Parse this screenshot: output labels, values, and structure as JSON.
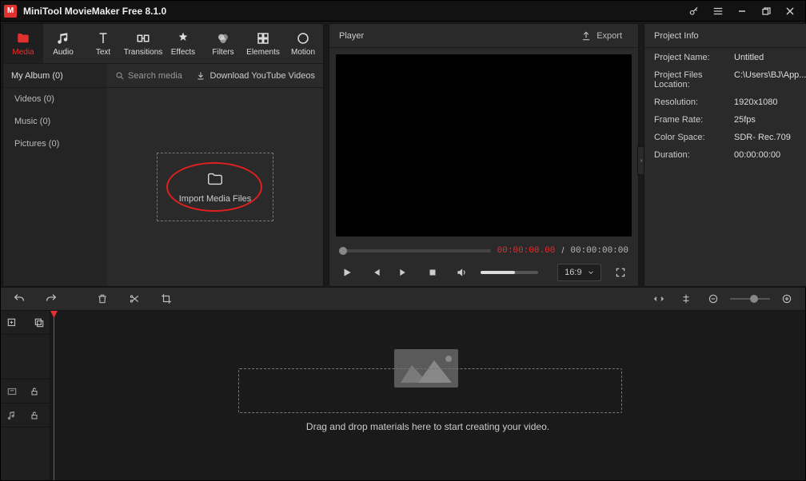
{
  "titlebar": {
    "app_title": "MiniTool MovieMaker Free 8.1.0"
  },
  "tabs": {
    "media": "Media",
    "audio": "Audio",
    "text": "Text",
    "transitions": "Transitions",
    "effects": "Effects",
    "filters": "Filters",
    "elements": "Elements",
    "motion": "Motion"
  },
  "albums": {
    "header": "My Album (0)",
    "videos": "Videos (0)",
    "music": "Music (0)",
    "pictures": "Pictures (0)"
  },
  "media_bar": {
    "search_placeholder": "Search media",
    "download_yt": "Download YouTube Videos"
  },
  "dropzone": {
    "label": "Import Media Files"
  },
  "player": {
    "header": "Player",
    "export": "Export",
    "time_current": "00:00:00.00",
    "time_total": "00:00:00:00",
    "ratio": "16:9"
  },
  "project": {
    "header": "Project Info",
    "rows": {
      "name_label": "Project Name:",
      "name_value": "Untitled",
      "loc_label": "Project Files Location:",
      "loc_value": "C:\\Users\\BJ\\App...",
      "res_label": "Resolution:",
      "res_value": "1920x1080",
      "fps_label": "Frame Rate:",
      "fps_value": "25fps",
      "cs_label": "Color Space:",
      "cs_value": "SDR- Rec.709",
      "dur_label": "Duration:",
      "dur_value": "00:00:00:00"
    }
  },
  "timeline": {
    "hint": "Drag and drop materials here to start creating your video."
  }
}
